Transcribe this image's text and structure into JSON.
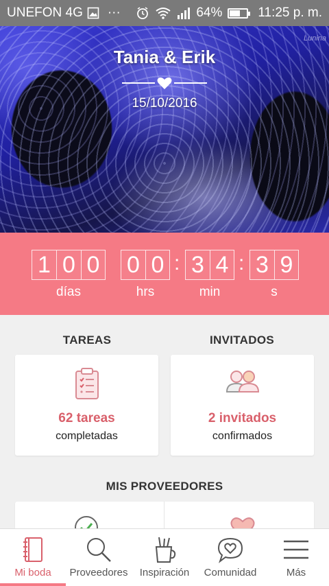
{
  "status_bar": {
    "carrier": "UNEFON 4G",
    "dots": "···",
    "battery": "64%",
    "battery_level": 0.64,
    "time": "11:25 p. m."
  },
  "hero": {
    "names": "Tania & Erik",
    "date": "15/10/2016",
    "watermark": "Lunina"
  },
  "countdown": {
    "days": [
      "1",
      "0",
      "0"
    ],
    "hours": [
      "0",
      "0"
    ],
    "minutes": [
      "3",
      "4"
    ],
    "seconds": [
      "3",
      "9"
    ],
    "separator": ":",
    "labels": {
      "days": "días",
      "hours": "hrs",
      "minutes": "min",
      "seconds": "s"
    }
  },
  "tareas": {
    "title": "TAREAS",
    "count": "62 tareas",
    "subtitle": "completadas",
    "icon": "clipboard-icon"
  },
  "invitados": {
    "title": "INVITADOS",
    "count": "2 invitados",
    "subtitle": "confirmados",
    "icon": "guests-icon"
  },
  "proveedores": {
    "title": "MIS PROVEEDORES"
  },
  "bottom_nav": [
    {
      "label": "Mi boda",
      "icon": "notebook-icon",
      "active": true
    },
    {
      "label": "Proveedores",
      "icon": "search-icon",
      "active": false
    },
    {
      "label": "Inspiración",
      "icon": "paint-cup-icon",
      "active": false
    },
    {
      "label": "Comunidad",
      "icon": "chat-heart-icon",
      "active": false
    },
    {
      "label": "Más",
      "icon": "menu-icon",
      "active": false
    }
  ],
  "colors": {
    "accent": "#f57a85",
    "accent_text": "#d9606b",
    "status_bar": "#7a7a7a"
  }
}
